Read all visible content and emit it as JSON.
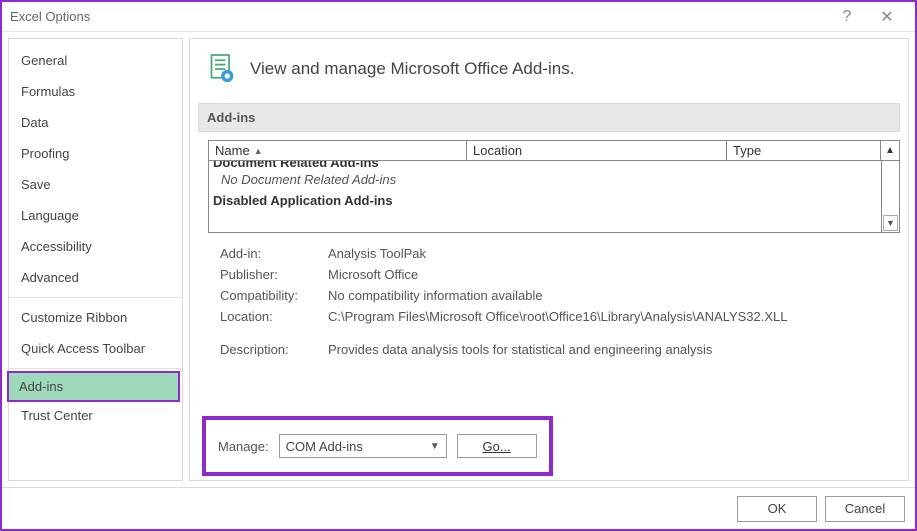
{
  "window": {
    "title": "Excel Options",
    "help_icon": "?",
    "close_icon": "✕"
  },
  "sidebar": {
    "items": [
      {
        "label": "General"
      },
      {
        "label": "Formulas"
      },
      {
        "label": "Data"
      },
      {
        "label": "Proofing"
      },
      {
        "label": "Save"
      },
      {
        "label": "Language"
      },
      {
        "label": "Accessibility"
      },
      {
        "label": "Advanced"
      }
    ],
    "items2": [
      {
        "label": "Customize Ribbon"
      },
      {
        "label": "Quick Access Toolbar"
      }
    ],
    "items3": [
      {
        "label": "Add-ins",
        "selected": true
      },
      {
        "label": "Trust Center"
      }
    ]
  },
  "page": {
    "heading": "View and manage Microsoft Office Add-ins.",
    "section_label": "Add-ins"
  },
  "table": {
    "columns": {
      "name": "Name",
      "location": "Location",
      "type": "Type"
    },
    "cut_group": "Document Related Add-ins",
    "empty_msg": "No Document Related Add-ins",
    "group2": "Disabled Application Add-ins"
  },
  "details": {
    "addin_label": "Add-in:",
    "addin_value": "Analysis ToolPak",
    "publisher_label": "Publisher:",
    "publisher_value": "Microsoft Office",
    "compat_label": "Compatibility:",
    "compat_value": "No compatibility information available",
    "location_label": "Location:",
    "location_value": "C:\\Program Files\\Microsoft Office\\root\\Office16\\Library\\Analysis\\ANALYS32.XLL",
    "desc_label": "Description:",
    "desc_value": "Provides data analysis tools for statistical and engineering analysis"
  },
  "manage": {
    "label": "Manage:",
    "selected": "COM Add-ins",
    "go_label": "Go..."
  },
  "footer": {
    "ok": "OK",
    "cancel": "Cancel"
  }
}
